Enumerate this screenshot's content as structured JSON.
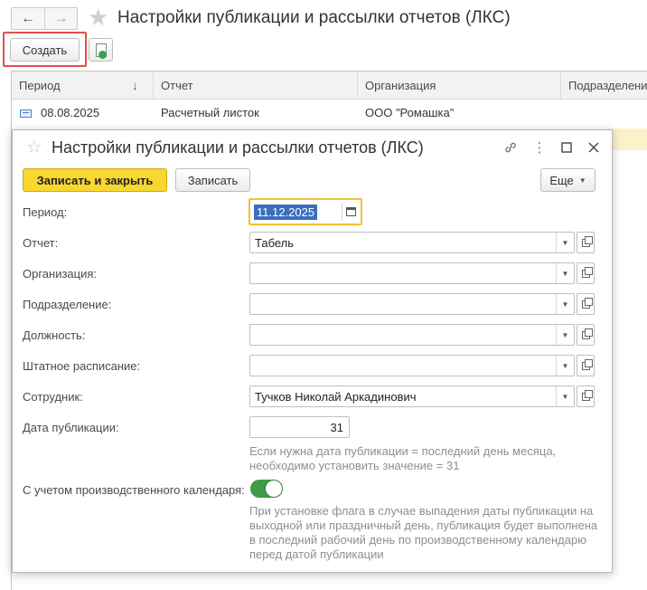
{
  "main": {
    "title": "Настройки публикации и рассылки отчетов (ЛКС)",
    "back_label": "←",
    "forward_label": "→",
    "star_glyph": "★",
    "create_label": "Создать",
    "columns": [
      "Период",
      "Отчет",
      "Организация",
      "Подразделение"
    ],
    "sort_glyph": "↓",
    "row": {
      "period": "08.08.2025",
      "report": "Расчетный листок",
      "organization": "ООО \"Ромашка\""
    }
  },
  "dialog": {
    "title": "Настройки публикации и рассылки отчетов (ЛКС)",
    "star_glyph": "☆",
    "link_glyph": "🔗",
    "more_glyph": "⋮",
    "maximize_glyph": "☐",
    "close_glyph": "✕",
    "save_close_label": "Записать и закрыть",
    "save_label": "Записать",
    "more_label": "Еще",
    "dropdown_glyph": "▼",
    "fields": {
      "period": {
        "label": "Период:",
        "value": "11.12.2025"
      },
      "report": {
        "label": "Отчет:",
        "value": "Табель"
      },
      "organization": {
        "label": "Организация:",
        "value": ""
      },
      "department": {
        "label": "Подразделение:",
        "value": ""
      },
      "position": {
        "label": "Должность:",
        "value": ""
      },
      "staffing": {
        "label": "Штатное расписание:",
        "value": ""
      },
      "employee": {
        "label": "Сотрудник:",
        "value": "Тучков Николай Аркадинович"
      },
      "publication_date": {
        "label": "Дата публикации:",
        "value": "31"
      },
      "calendar": {
        "label": "С учетом производственного календаря:",
        "checked": true
      }
    },
    "hint_date_1": "Если нужна дата публикации = последний день месяца,",
    "hint_date_2": "необходимо установить значение = 31",
    "hint_cal_1": "При установке флага в случае выпадения даты публикации на",
    "hint_cal_2": "выходной или праздничный день, публикация будет выполнена",
    "hint_cal_3": "в последний рабочий день по производственному календарю",
    "hint_cal_4": "перед датой публикации"
  },
  "colors": {
    "accent_yellow": "#f7d730",
    "toggle_green": "#3e9a47",
    "highlight_red": "#e0504c",
    "selection_blue": "#3c6ebd"
  }
}
